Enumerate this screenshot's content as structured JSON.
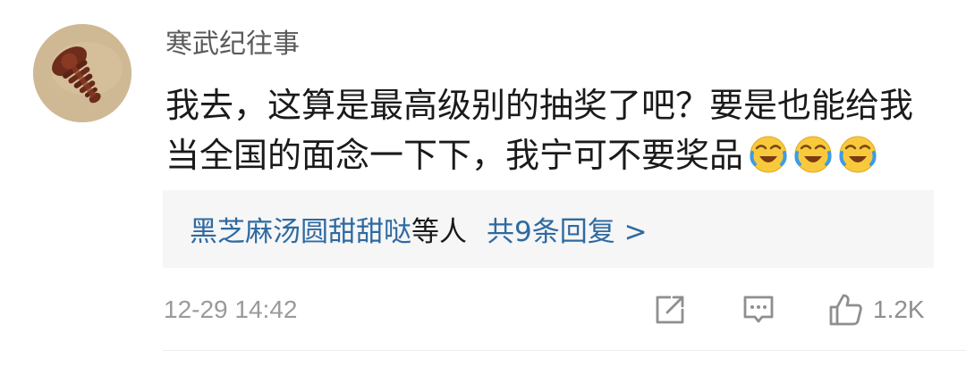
{
  "comment": {
    "username": "寒武纪往事",
    "text": "我去，这算是最高级别的抽奖了吧？要是也能给我当全国的面念一下下，我宁可不要奖品",
    "emoji_icon": "laughing-crying-emoji",
    "emoji_count": 3,
    "replies": {
      "names": "黑芝麻汤圆甜甜哒",
      "middle": "等人",
      "count_text": "共9条回复 >"
    },
    "timestamp": "12-29 14:42",
    "actions": {
      "share_icon": "share-icon",
      "reply_icon": "comment-icon",
      "like_icon": "thumbs-up-icon",
      "like_count": "1.2K"
    }
  },
  "colors": {
    "link": "#2f6aa0",
    "reply_box": "#f6f6f7",
    "meta_text": "#9a9a9a"
  }
}
